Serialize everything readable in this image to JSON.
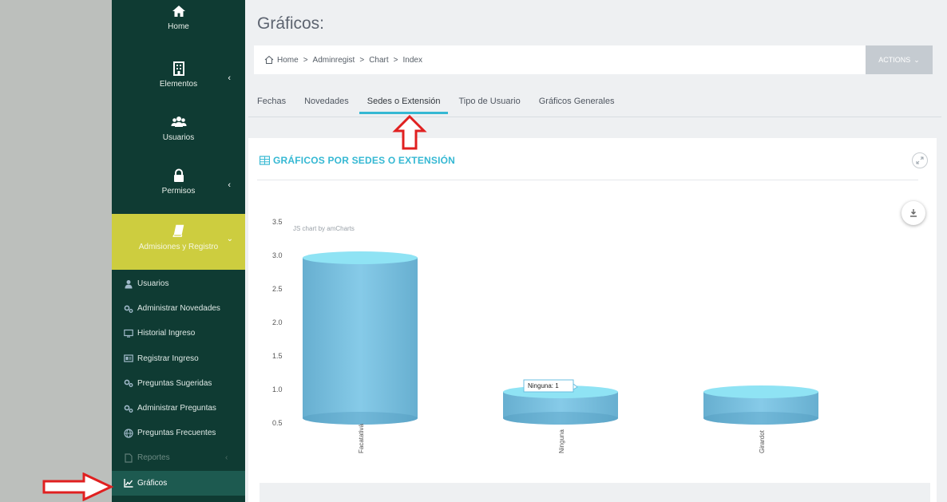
{
  "sidebar": {
    "top_items": [
      {
        "label": "Home",
        "icon": "home-icon"
      },
      {
        "label": "Elementos",
        "icon": "building-icon"
      },
      {
        "label": "Usuarios",
        "icon": "users-icon"
      },
      {
        "label": "Permisos",
        "icon": "lock-icon"
      }
    ],
    "active_group": {
      "label": "Admisiones y Registro",
      "icon": "book-icon"
    },
    "sub_items": [
      {
        "label": "Usuarios",
        "icon": "user-icon"
      },
      {
        "label": "Administrar Novedades",
        "icon": "cogs-icon"
      },
      {
        "label": "Historial Ingreso",
        "icon": "monitor-icon"
      },
      {
        "label": "Registrar Ingreso",
        "icon": "id-card-icon"
      },
      {
        "label": "Preguntas Sugeridas",
        "icon": "cogs-icon"
      },
      {
        "label": "Administrar Preguntas",
        "icon": "cogs-icon"
      },
      {
        "label": "Preguntas Frecuentes",
        "icon": "globe-icon"
      },
      {
        "label": "Reportes",
        "icon": "file-icon"
      },
      {
        "label": "Gráficos",
        "icon": "line-chart-icon"
      }
    ]
  },
  "header": {
    "title": "Gráficos:",
    "breadcrumb": [
      "Home",
      "Adminregist",
      "Chart",
      "Index"
    ],
    "actions_label": "ACTIONS"
  },
  "tabs": [
    "Fechas",
    "Novedades",
    "Sedes o Extensión",
    "Tipo de Usuario",
    "Gráficos Generales"
  ],
  "active_tab": "Sedes o Extensión",
  "portlet": {
    "title": "GRÁFICOS POR SEDES O EXTENSIÓN",
    "credit": "JS chart by amCharts"
  },
  "chart_data": {
    "type": "bar",
    "categories": [
      "Facatativá",
      "Ninguna",
      "Girardot"
    ],
    "values": [
      3,
      1,
      1
    ],
    "ylim": [
      0.5,
      3.5
    ],
    "yticks": [
      "3.5",
      "3.0",
      "2.5",
      "2.0",
      "1.5",
      "1.0",
      "0.5"
    ],
    "tooltip": "Ninguna: 1",
    "bar_color": "#6bbfe0",
    "bar_top_color": "#8fe3f4"
  },
  "colors": {
    "sidebar_bg": "#0f3b33",
    "active_group_bg": "#cdcd3f",
    "accent": "#35b8d3",
    "annotation": "#e02020"
  }
}
